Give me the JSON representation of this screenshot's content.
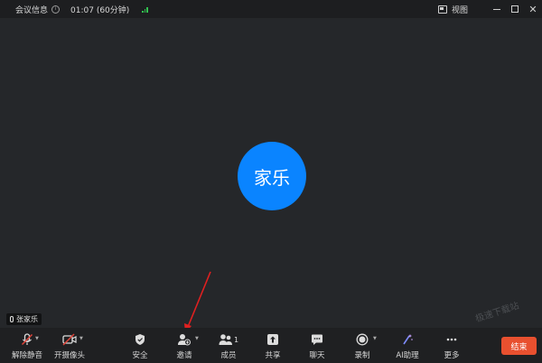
{
  "titlebar": {
    "meeting_info": "会议信息",
    "info_icon": "info-icon",
    "duration": "01:07 (60分钟)",
    "signal_icon": "signal-strength-icon",
    "view_label": "视图",
    "view_icon": "view-layout-icon"
  },
  "main": {
    "avatar_text": "家乐",
    "participant_name": "张家乐",
    "watermark": "极速下载站"
  },
  "toolbar": {
    "unmute": "解除静音",
    "camera": "开摄像头",
    "security": "安全",
    "invite": "邀请",
    "members": "成员",
    "member_count": "1",
    "share": "共享",
    "chat": "聊天",
    "record": "录制",
    "ai_assistant": "AI助理",
    "more": "更多",
    "end": "结束"
  },
  "colors": {
    "avatar": "#0a84ff",
    "end_button": "#e8502f",
    "muted": "#e0443a",
    "signal": "#31c24f",
    "annotation_arrow": "#e02020"
  }
}
